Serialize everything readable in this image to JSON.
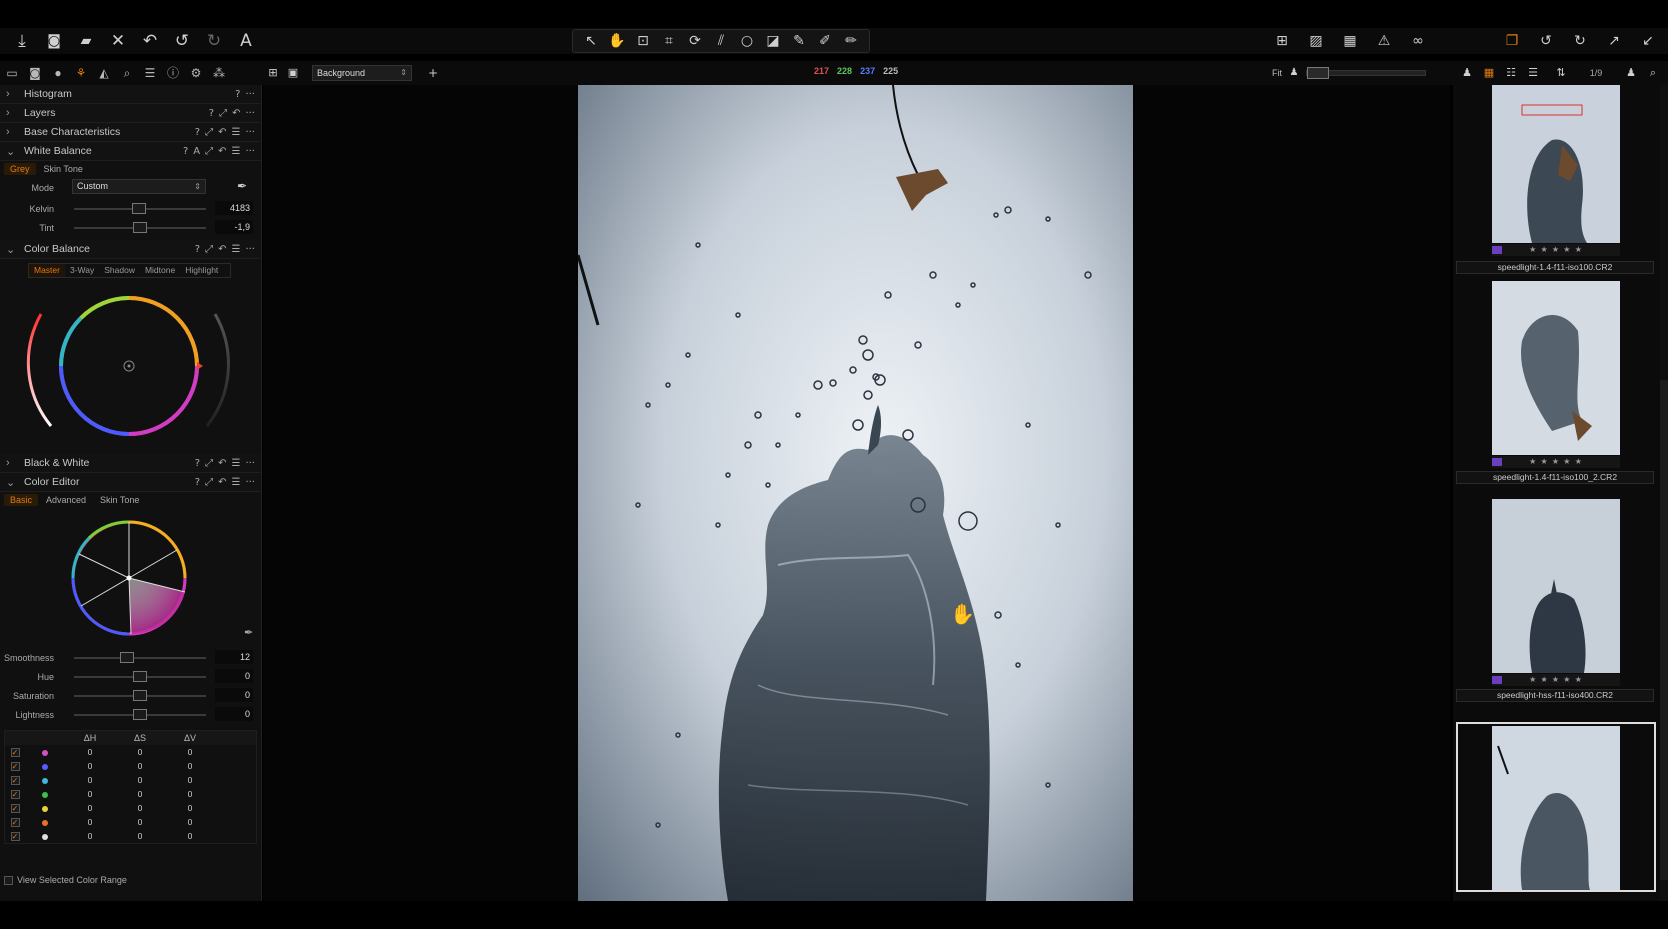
{
  "top_toolbar": {
    "left_icons": [
      "import-icon",
      "camera-icon",
      "export-icon",
      "delete-icon",
      "undo-all-icon",
      "undo-icon",
      "redo-icon",
      "annotation-icon"
    ],
    "center_icons": [
      "select-pointer-icon",
      "pan-hand-icon",
      "loupe-icon",
      "crop-icon",
      "rotate-icon",
      "keystone-icon",
      "spot-removal-icon",
      "mask-draw-icon",
      "brush-icon",
      "gradient-icon",
      "eraser-icon"
    ],
    "right_icons": [
      "grid-view-icon",
      "proof-icon",
      "overlay-icon",
      "exposure-warning-icon",
      "before-after-icon",
      "copy-adjust-icon",
      "reset-icon",
      "apply-icon",
      "expand-icon",
      "collapse-icon"
    ]
  },
  "viewer_bar": {
    "background_select": "Background",
    "rgb": {
      "r": "217",
      "g": "228",
      "b": "237",
      "l": "225"
    },
    "fit_label": "Fit",
    "counter": "1/9"
  },
  "tools": {
    "histogram": "Histogram",
    "layers": "Layers",
    "base_characteristics": "Base Characteristics",
    "white_balance": {
      "title": "White Balance",
      "tabs": [
        "Grey",
        "Skin Tone"
      ],
      "mode_label": "Mode",
      "mode_value": "Custom",
      "kelvin_label": "Kelvin",
      "kelvin_value": "4183",
      "tint_label": "Tint",
      "tint_value": "-1,9"
    },
    "color_balance": {
      "title": "Color Balance",
      "tabs": [
        "Master",
        "3-Way",
        "Shadow",
        "Midtone",
        "Highlight"
      ]
    },
    "black_white": "Black & White",
    "color_editor": {
      "title": "Color Editor",
      "tabs": [
        "Basic",
        "Advanced",
        "Skin Tone"
      ],
      "smoothness_label": "Smoothness",
      "smoothness_value": "12",
      "hue_label": "Hue",
      "hue_value": "0",
      "saturation_label": "Saturation",
      "saturation_value": "0",
      "lightness_label": "Lightness",
      "lightness_value": "0",
      "table_headers": [
        "ΔH",
        "ΔS",
        "ΔV"
      ],
      "rows": [
        {
          "color": "#d34fc2",
          "h": "0",
          "s": "0",
          "v": "0"
        },
        {
          "color": "#5a5aff",
          "h": "0",
          "s": "0",
          "v": "0"
        },
        {
          "color": "#3fb8d8",
          "h": "0",
          "s": "0",
          "v": "0"
        },
        {
          "color": "#3fbf4a",
          "h": "0",
          "s": "0",
          "v": "0"
        },
        {
          "color": "#e8d33a",
          "h": "0",
          "s": "0",
          "v": "0"
        },
        {
          "color": "#e8702a",
          "h": "0",
          "s": "0",
          "v": "0"
        },
        {
          "color": "#e0e0e0",
          "h": "0",
          "s": "0",
          "v": "0"
        }
      ],
      "view_selected": "View Selected Color Range"
    }
  },
  "browser": {
    "thumbs": [
      {
        "name": "speedlight-1.4-f11-iso100.CR2",
        "stars": "★ ★ ★ ★ ★"
      },
      {
        "name": "speedlight-1.4-f11-iso100_2.CR2",
        "stars": "★ ★ ★ ★ ★"
      },
      {
        "name": "speedlight-hss-f11-iso400.CR2",
        "stars": "★ ★ ★ ★ ★"
      },
      {
        "name": "",
        "stars": ""
      }
    ]
  },
  "colors": {
    "accent": "#e07a12",
    "panel_bg": "#101010"
  }
}
